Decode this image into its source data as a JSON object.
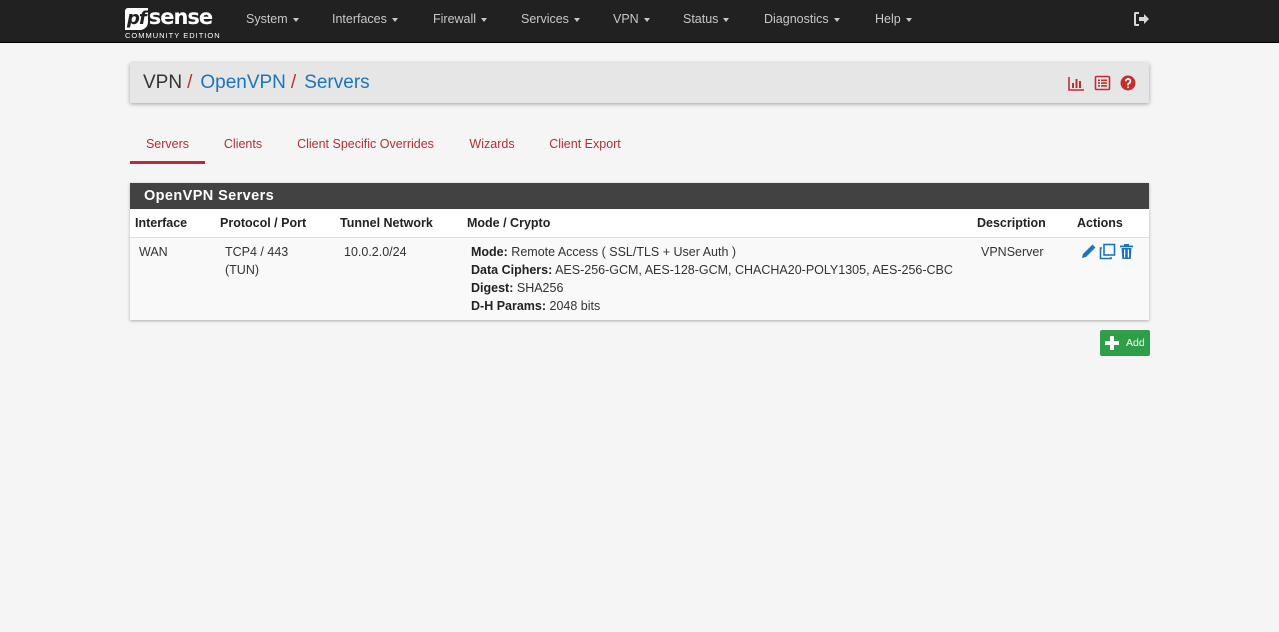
{
  "brand": {
    "logo_pf": "pf",
    "logo_sense": "sense",
    "edition": "COMMUNITY EDITION"
  },
  "nav": {
    "items": [
      "System",
      "Interfaces",
      "Firewall",
      "Services",
      "VPN",
      "Status",
      "Diagnostics",
      "Help"
    ]
  },
  "breadcrumb": {
    "level1": "VPN",
    "sep": "/",
    "level2": "OpenVPN",
    "level3": "Servers"
  },
  "tabs": [
    "Servers",
    "Clients",
    "Client Specific Overrides",
    "Wizards",
    "Client Export"
  ],
  "panel": {
    "title": "OpenVPN Servers",
    "columns": [
      "Interface",
      "Protocol / Port",
      "Tunnel Network",
      "Mode / Crypto",
      "Description",
      "Actions"
    ],
    "row": {
      "interface": "WAN",
      "protocol_line1": "TCP4 / 443",
      "protocol_line2": "(TUN)",
      "tunnel_network": "10.0.2.0/24",
      "mode_label": "Mode:",
      "mode_value": "Remote Access ( SSL/TLS + User Auth )",
      "ciphers_label": "Data Ciphers:",
      "ciphers_value": "AES-256-GCM, AES-128-GCM, CHACHA20-POLY1305, AES-256-CBC",
      "digest_label": "Digest:",
      "digest_value": "SHA256",
      "dh_label": "D-H Params:",
      "dh_value": "2048 bits",
      "description": "VPNServer"
    }
  },
  "add_button": {
    "label": "Add"
  },
  "colors": {
    "navbar": "#212121",
    "link_red": "#b52e31",
    "link_blue": "#1c75bc",
    "panel_heading": "#424242",
    "add_green": "#2e9e48"
  }
}
